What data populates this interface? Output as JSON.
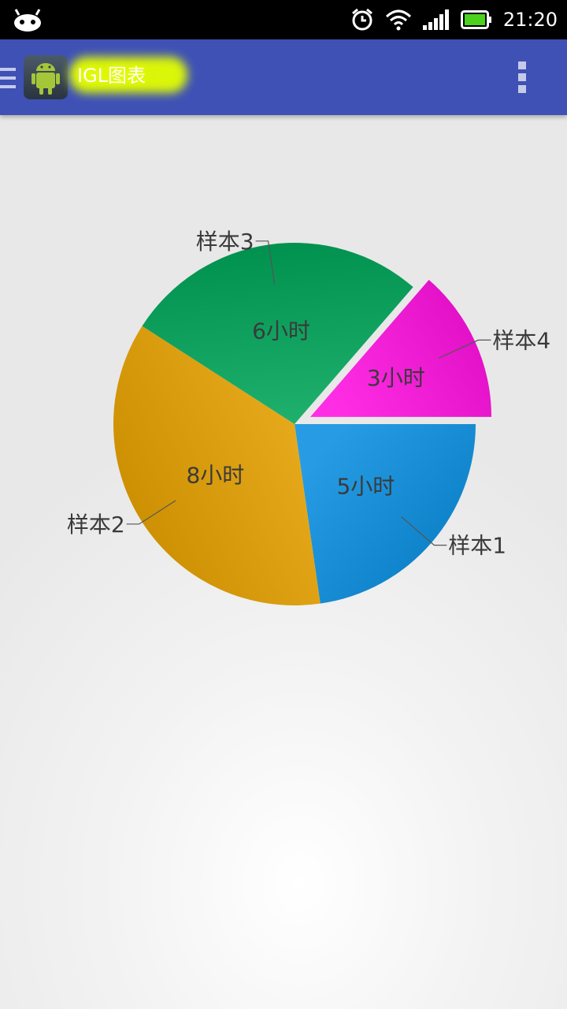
{
  "status_bar": {
    "time": "21:20",
    "icons": [
      "android-icon",
      "alarm-icon",
      "wifi-icon",
      "signal-icon",
      "battery-icon"
    ]
  },
  "app_bar": {
    "title": "IGL图表",
    "icons": [
      "drawer-menu-icon",
      "android-app-icon",
      "overflow-menu-icon"
    ],
    "background": "#3f51b5"
  },
  "chart_data": {
    "type": "pie",
    "title": "",
    "unit": "小时",
    "slices": [
      {
        "label": "样本1",
        "value": 5,
        "value_label": "5小时",
        "color": "#0a8fe0"
      },
      {
        "label": "样本2",
        "value": 8,
        "value_label": "8小时",
        "color": "#e6a100"
      },
      {
        "label": "样本3",
        "value": 6,
        "value_label": "6小时",
        "color": "#00a55a"
      },
      {
        "label": "样本4",
        "value": 3,
        "value_label": "3小时",
        "color": "#ff10e0",
        "exploded": true
      }
    ]
  }
}
